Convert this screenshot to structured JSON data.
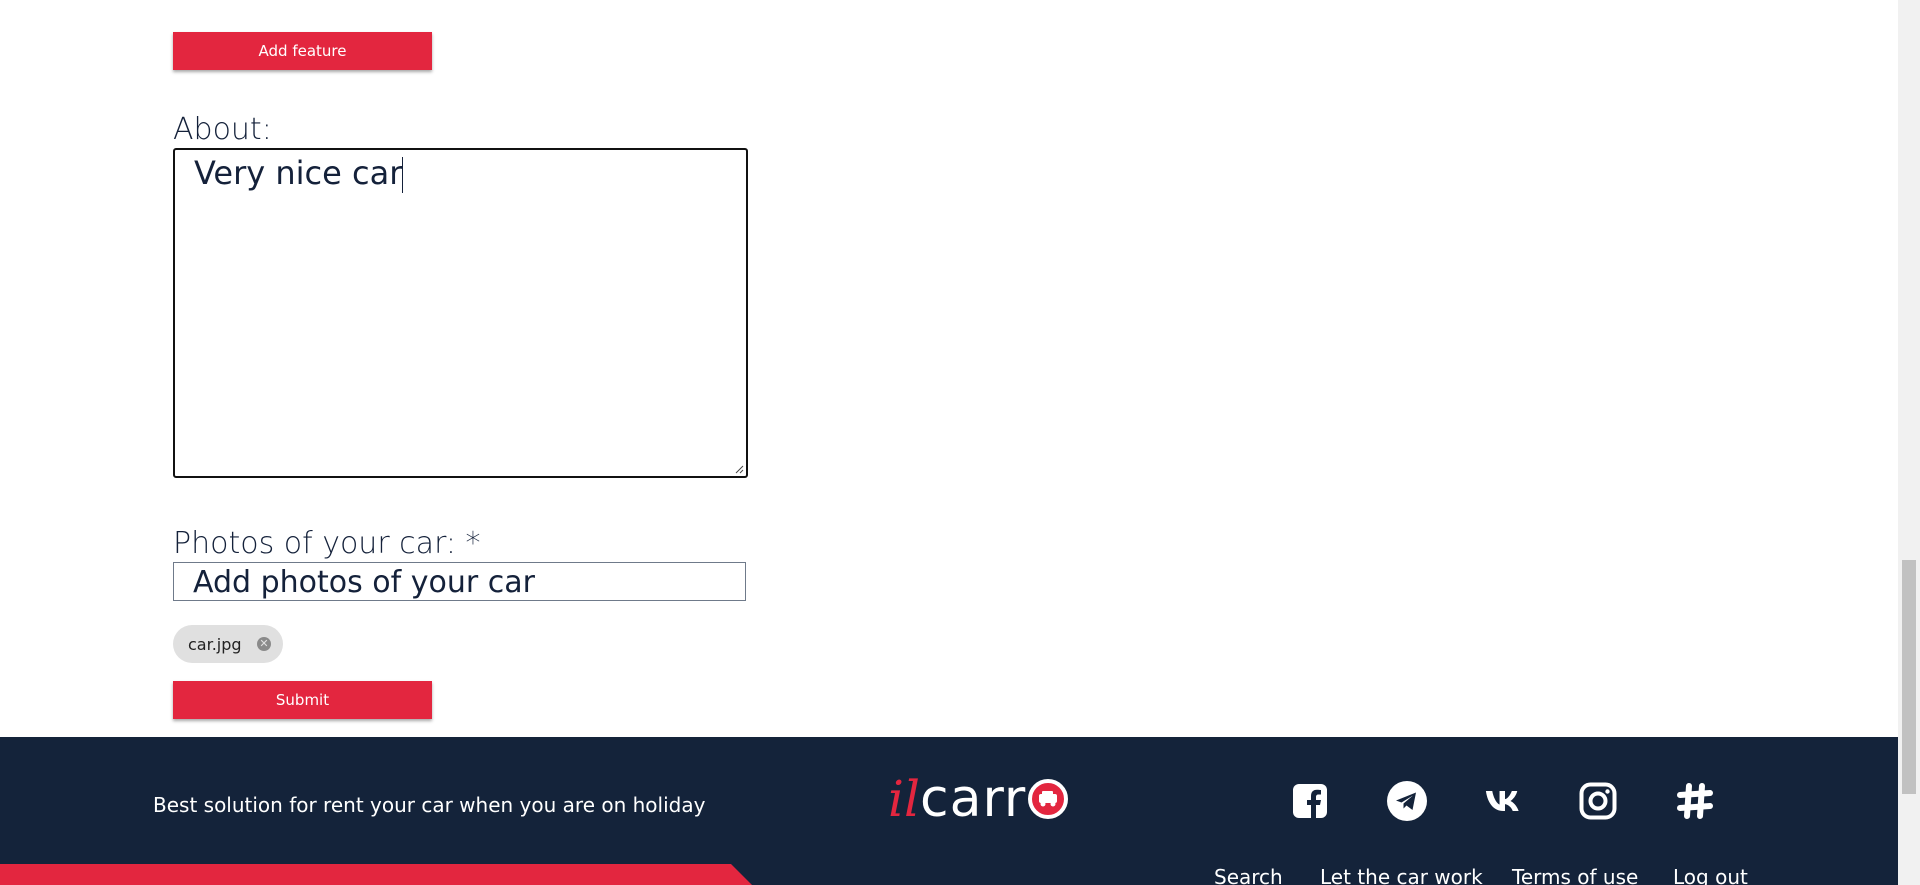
{
  "form": {
    "add_feature_label": "Add feature",
    "about_label": "About:",
    "about_value": "Very nice car",
    "photos_label": "Photos of your car: *",
    "photos_placeholder": "Add photos of your car",
    "uploaded_files": [
      "car.jpg"
    ],
    "submit_label": "Submit"
  },
  "footer": {
    "tagline": "Best solution for rent your car when you are on holiday",
    "logo_prefix": "il",
    "logo_main": "carr",
    "social_icons": [
      "facebook-icon",
      "telegram-icon",
      "vk-icon",
      "instagram-icon",
      "slack-icon"
    ],
    "links": [
      "Search",
      "Let the car work",
      "Terms of use",
      "Log out"
    ]
  },
  "colors": {
    "accent": "#e3263f",
    "footer_bg": "#14233a",
    "text": "#14213a"
  }
}
